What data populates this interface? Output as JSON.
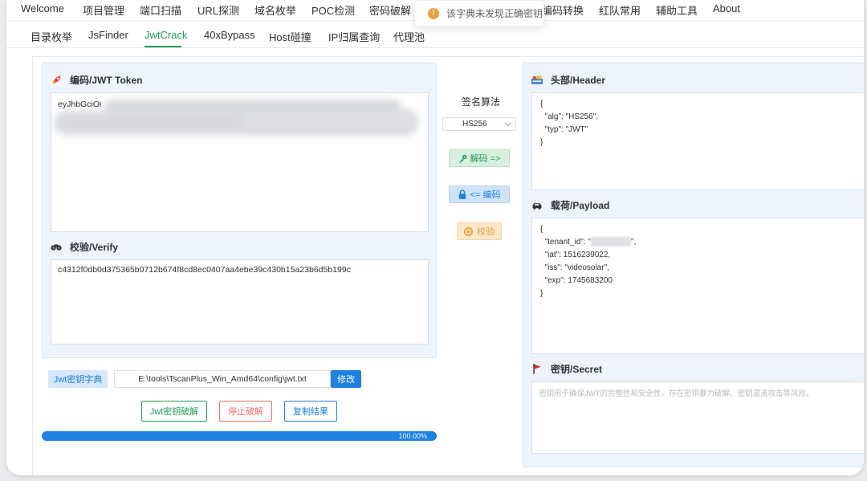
{
  "top_nav": {
    "items": [
      "Welcome",
      "项目管理",
      "端口扫描",
      "URL探测",
      "域名枚举",
      "POC检测",
      "密码破解",
      "编码转换",
      "红队常用",
      "辅助工具",
      "About"
    ]
  },
  "toast": {
    "icon": "warning-icon",
    "message": "该字典未发现正确密钥"
  },
  "sub_nav": {
    "tabs": [
      "目录枚举",
      "JsFinder",
      "JwtCrack",
      "40xBypass",
      "Host碰撞",
      "IP归属查询",
      "代理池"
    ],
    "active": "JwtCrack"
  },
  "token_panel": {
    "title": "编码/JWT Token",
    "icon": "rocket-icon",
    "value_prefix": "eyJhbGciOi"
  },
  "verify_panel": {
    "title": "校验/Verify",
    "icon": "binoculars-icon",
    "value": "c4312f0db0d375365b0712b674f8cd8ec0407aa4ebe39c430b15a23b6d5b199c"
  },
  "algorithm": {
    "label": "签名算法",
    "selected": "HS256"
  },
  "actions": {
    "decode": "解码 =>",
    "encode": "<= 编码",
    "verify": "校验"
  },
  "header_panel": {
    "title": "头部/Header",
    "icon": "header-icon",
    "lines": [
      "{",
      "  \"alg\": \"HS256\",",
      "  \"typ\": \"JWT\"",
      "}"
    ]
  },
  "payload_panel": {
    "title": "载荷/Payload",
    "icon": "car-icon",
    "open": "{",
    "tenant_prefix": "  \"tenant_id\": \"",
    "tenant_suffix": "\",",
    "lines": [
      "  \"iat\": 1516239022,",
      "  \"iss\": \"videosolar\",",
      "  \"exp\": 1745683200",
      "}"
    ]
  },
  "secret_panel": {
    "title": "密钥/Secret",
    "icon": "flag-icon",
    "placeholder": "密钥用于确保JWT的完整性和安全性，存在密钥暴力破解、密钥混淆攻击等风险。"
  },
  "dictionary": {
    "label": "Jwt密钥字典",
    "path": "E:\\tools\\TscanPlus_Win_Amd64\\config\\jwt.txt",
    "modify": "修改"
  },
  "crack_buttons": {
    "start": "Jwt密钥破解",
    "stop": "停止破解",
    "copy": "复制结果"
  },
  "progress": {
    "value": 1.0,
    "label": "100.00%"
  },
  "colors": {
    "accent_green": "#1f9d55",
    "primary_blue": "#1e80e0",
    "danger_red": "#f56c6c",
    "warning_orange": "#e6a23c"
  }
}
